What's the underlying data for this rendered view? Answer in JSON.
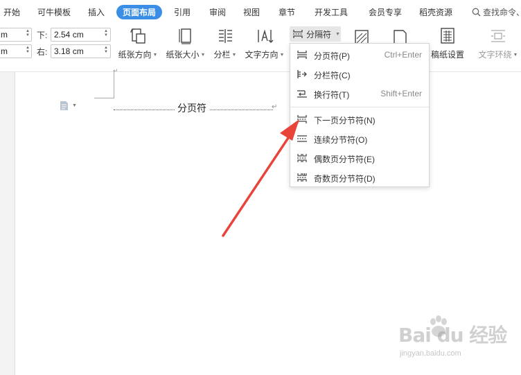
{
  "menu": {
    "tabs": [
      "开始",
      "可牛模板",
      "插入",
      "页面布局",
      "引用",
      "审阅",
      "视图",
      "章节",
      "开发工具",
      "会员专享",
      "稻壳资源"
    ],
    "active_tab": "页面布局",
    "search_label": "查找命令、"
  },
  "margins": {
    "top_value_left": "m",
    "bottom_value_left": "m",
    "bottom_label": "下:",
    "bottom_value": "2.54 cm",
    "right_label": "右:",
    "right_value": "3.18 cm"
  },
  "ribbon": {
    "orientation": "纸张方向",
    "size": "纸张大小",
    "columns": "分栏",
    "text_direction": "文字方向",
    "separator": "分隔符",
    "manuscript": "稿纸设置",
    "text_wrap": "文字环绕"
  },
  "dropdown": {
    "items": [
      {
        "label": "分页符(P)",
        "shortcut": "Ctrl+Enter"
      },
      {
        "label": "分栏符(C)",
        "shortcut": ""
      },
      {
        "label": "换行符(T)",
        "shortcut": "Shift+Enter"
      },
      {
        "label": "下一页分节符(N)",
        "shortcut": ""
      },
      {
        "label": "连续分节符(O)",
        "shortcut": ""
      },
      {
        "label": "偶数页分节符(E)",
        "shortcut": ""
      },
      {
        "label": "奇数页分节符(D)",
        "shortcut": ""
      }
    ]
  },
  "document": {
    "page_break_label": "分页符"
  },
  "watermark": {
    "brand": "Bai du 经验",
    "url": "jingyan.baidu.com"
  },
  "colors": {
    "accent": "#3a8ee6",
    "arrow": "#e8443a"
  }
}
